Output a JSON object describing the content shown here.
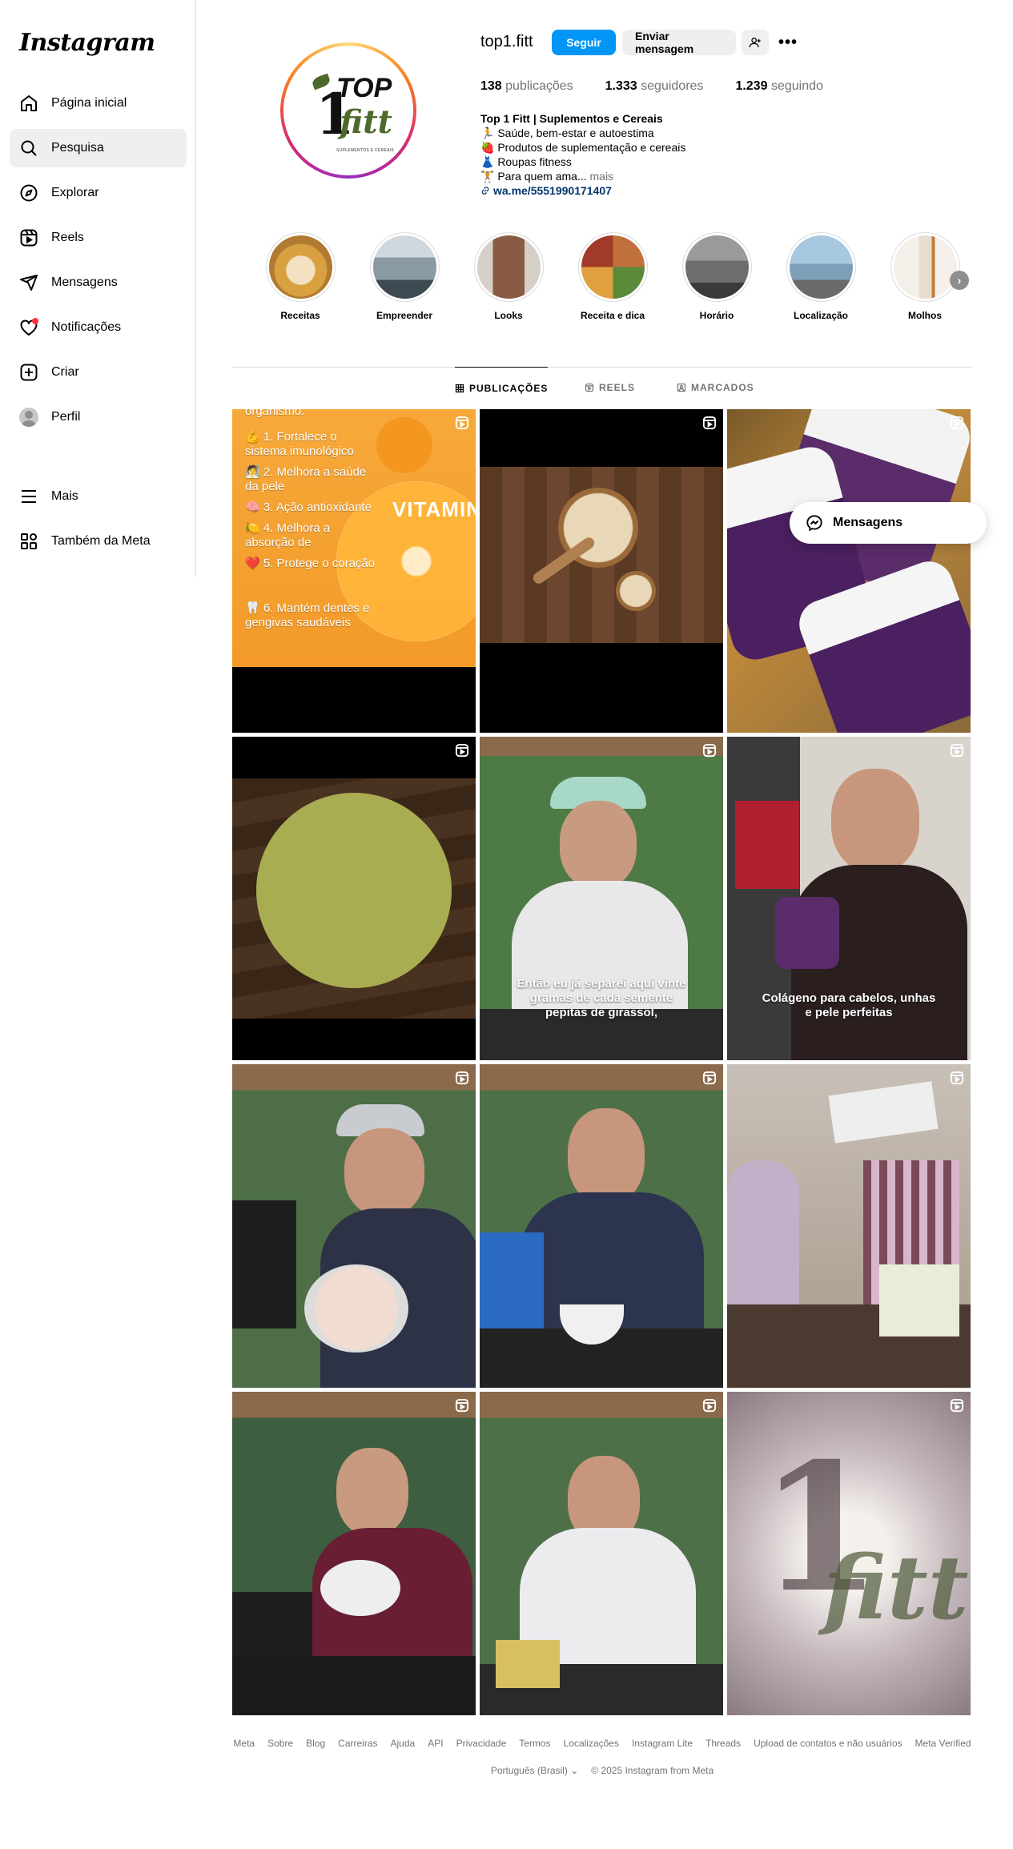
{
  "sidebar": {
    "logo": "Instagram",
    "items": [
      {
        "label": "Página inicial",
        "icon": "home-icon"
      },
      {
        "label": "Pesquisa",
        "icon": "search-icon",
        "active": true
      },
      {
        "label": "Explorar",
        "icon": "compass-icon"
      },
      {
        "label": "Reels",
        "icon": "reels-icon"
      },
      {
        "label": "Mensagens",
        "icon": "send-icon"
      },
      {
        "label": "Notificações",
        "icon": "heart-icon"
      },
      {
        "label": "Criar",
        "icon": "plus-icon"
      },
      {
        "label": "Perfil",
        "icon": "avatar"
      }
    ],
    "bottom": [
      {
        "label": "Mais",
        "icon": "menu-icon"
      },
      {
        "label": "Também da Meta",
        "icon": "meta-apps-icon"
      }
    ]
  },
  "profile": {
    "username": "top1.fitt",
    "follow_label": "Seguir",
    "message_label": "Enviar mensagem",
    "logo_text": {
      "top": "TOP",
      "one": "1",
      "fitt": "fitt",
      "sub": "SUPLEMENTOS E CEREAIS"
    },
    "stats": {
      "posts_count": "138",
      "posts_label": "publicações",
      "followers_count": "1.333",
      "followers_label": "seguidores",
      "following_count": "1.239",
      "following_label": "seguindo"
    },
    "bio": {
      "name": "Top 1 Fitt | Suplementos e Cereais",
      "line1": "🏃 Saúde, bem-estar e autoestima",
      "line2": "🍓 Produtos de suplementação e cereais",
      "line3": "👗 Roupas fitness",
      "line4": "🏋 Para quem ama...",
      "more": "mais",
      "link": "wa.me/5551990171407"
    }
  },
  "highlights": [
    {
      "label": "Receitas",
      "color": "#d9a040"
    },
    {
      "label": "Empreender",
      "color": "#8a9aa4"
    },
    {
      "label": "Looks",
      "color": "#8a5a42"
    },
    {
      "label": "Receita e dica",
      "color": "#c0703a"
    },
    {
      "label": "Horário",
      "color": "#6d6d6d"
    },
    {
      "label": "Localização",
      "color": "#7ca0b8"
    },
    {
      "label": "Molhos",
      "color": "#e6dccf"
    }
  ],
  "tabs": [
    {
      "label": "PUBLICAÇÕES",
      "icon": "grid-icon",
      "active": true
    },
    {
      "label": "REELS",
      "icon": "reels-small-icon"
    },
    {
      "label": "MARCADOS",
      "icon": "tagged-icon"
    }
  ],
  "posts": {
    "p1_lines": [
      "organismo.",
      "💪 1. Fortalece o sistema imunológico",
      "🧖 2. Melhora a saúde da pele",
      "🧠 3. Ação antioxidante",
      "🍋 4. Melhora a absorção de",
      "❤️ 5. Protege o coração",
      "🦷 6. Mantém dentes e gengivas saudáveis"
    ],
    "p1_word": "VITAMIN",
    "p5_caption": "Então eu já separei aqui vinte gramas de cada semente pepitas de girassol,",
    "p6_caption": "Colágeno para cabelos, unhas e pele perfeitas"
  },
  "messages_pill": "Mensagens",
  "footer": {
    "links": [
      "Meta",
      "Sobre",
      "Blog",
      "Carreiras",
      "Ajuda",
      "API",
      "Privacidade",
      "Termos",
      "Localizações",
      "Instagram Lite",
      "Threads",
      "Upload de contatos e não usuários",
      "Meta Verified"
    ],
    "language": "Português (Brasil)",
    "copyright": "© 2025 Instagram from Meta"
  }
}
